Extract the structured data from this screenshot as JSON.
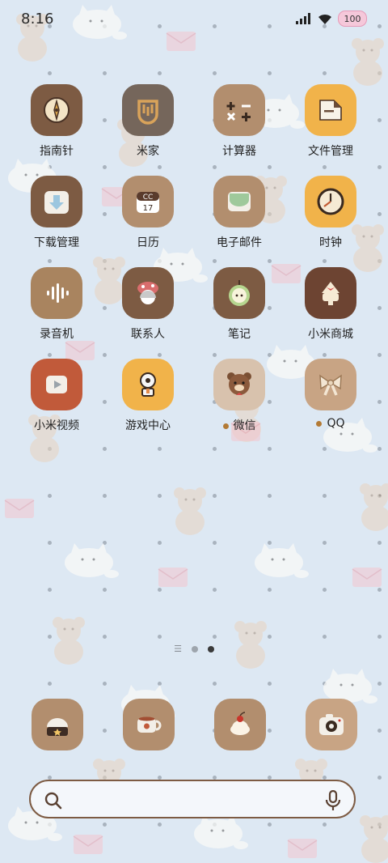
{
  "status_bar": {
    "time": "8:16",
    "battery": "100"
  },
  "home_grid": [
    {
      "label": "指南针",
      "icon": "compass-icon",
      "bg": "#7d5b43"
    },
    {
      "label": "米家",
      "icon": "mijia-icon",
      "bg": "#75665b"
    },
    {
      "label": "计算器",
      "icon": "calculator-icon",
      "bg": "#b28e6e"
    },
    {
      "label": "文件管理",
      "icon": "folder-icon",
      "bg": "#f1b34a"
    },
    {
      "label": "下载管理",
      "icon": "download-icon",
      "bg": "#7d5b43"
    },
    {
      "label": "日历",
      "icon": "calendar-icon",
      "bg": "#b28e6e",
      "date": "17"
    },
    {
      "label": "电子邮件",
      "icon": "mail-icon",
      "bg": "#b28e6e"
    },
    {
      "label": "时钟",
      "icon": "clock-icon",
      "bg": "#f1b34a"
    },
    {
      "label": "录音机",
      "icon": "recorder-icon",
      "bg": "#a9845f"
    },
    {
      "label": "联系人",
      "icon": "contacts-icon",
      "bg": "#7d5b43"
    },
    {
      "label": "笔记",
      "icon": "notes-apple-icon",
      "bg": "#7d5b43"
    },
    {
      "label": "小米商城",
      "icon": "store-cake-icon",
      "bg": "#6d4432"
    },
    {
      "label": "小米视频",
      "icon": "video-icon",
      "bg": "#c15a3a"
    },
    {
      "label": "游戏中心",
      "icon": "game-center-icon",
      "bg": "#f1b34a"
    },
    {
      "label": "微信",
      "icon": "bear-wechat-icon",
      "bg": "#d8c2ad",
      "badge": true
    },
    {
      "label": "QQ",
      "icon": "bow-qq-icon",
      "bg": "#c8a484",
      "badge": true
    }
  ],
  "pager": {
    "pages": 2,
    "active": 2
  },
  "dock": [
    {
      "icon": "phone-bun-icon",
      "bg": "#b28e6e"
    },
    {
      "icon": "teacup-icon",
      "bg": "#b28e6e"
    },
    {
      "icon": "cake-icon",
      "bg": "#b28e6e"
    },
    {
      "icon": "camera-icon",
      "bg": "#c8a484"
    }
  ],
  "colors": {
    "accent": "#7d5b43",
    "wallpaper": "#dde8f3"
  }
}
